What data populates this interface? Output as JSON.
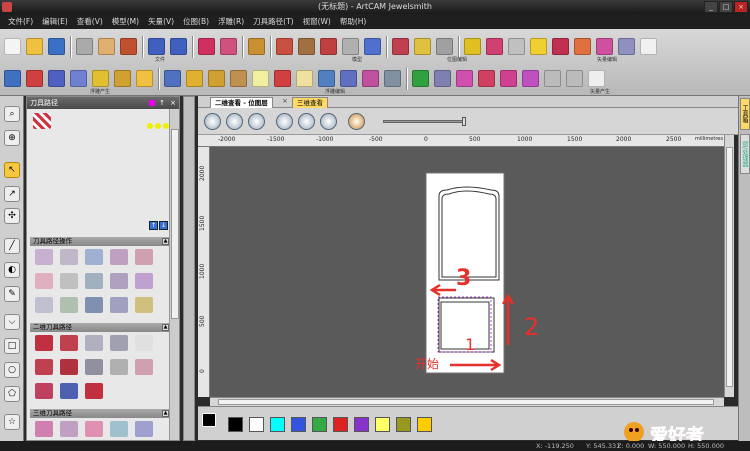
{
  "window": {
    "title": "(无标题) - ArtCAM Jewelsmith",
    "buttons": {
      "minimize": "_",
      "maximize": "□",
      "close": "×"
    }
  },
  "menubar": [
    "文件(F)",
    "编辑(E)",
    "查看(V)",
    "模型(M)",
    "矢量(V)",
    "位图(B)",
    "浮雕(R)",
    "刀具路径(T)",
    "视窗(W)",
    "帮助(H)"
  ],
  "toolbar_groups": {
    "file": "文件",
    "model": "模型",
    "bitmap": "位图编辑",
    "vector_edit": "矢量编辑",
    "relief_build": "浮雕产生",
    "relief_edit": "浮雕编辑",
    "vector_create": "矢量产生"
  },
  "left_panel": {
    "title": "刀具路径",
    "pin": "↑",
    "close": "×",
    "sections": [
      "刀具路径操作",
      "二维刀具路径",
      "三维刀具路径"
    ]
  },
  "view_tabs": [
    "二维查看 - 位图层",
    "三维查看"
  ],
  "tab_close": "×",
  "rulers": {
    "horizontal": [
      "-2000",
      "-1500",
      "-1000",
      "-500",
      "0",
      "500",
      "1000",
      "1500",
      "2000",
      "2500",
      "millimetres"
    ],
    "vertical": [
      "2000",
      "1500",
      "1000",
      "500",
      "0"
    ]
  },
  "annotations": {
    "label_1": "1",
    "label_2": "2",
    "label_3": "3",
    "start_text": "开始",
    "annotation_color": "#e8302a"
  },
  "palette_colors": [
    "#000000",
    "#ffffff",
    "#00ffff",
    "#3355dd",
    "#33aa44",
    "#dd2222",
    "#8833cc",
    "#ffff66",
    "#999922",
    "#ffcc00"
  ],
  "status": {
    "x": "X: -119.250",
    "y": "Y: 545.331",
    "z": "Z: 0.000",
    "w": "W: 550.000",
    "h": "H: 550.000"
  },
  "right_dock": [
    "工具箱",
    "层/处理器"
  ],
  "watermark": "爱好者"
}
